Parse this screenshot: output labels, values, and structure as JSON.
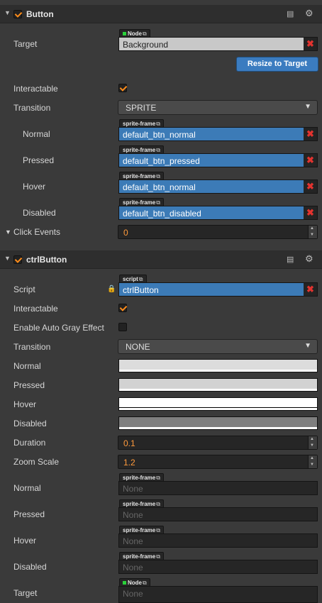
{
  "button_component": {
    "title": "Button",
    "target": {
      "label": "Target",
      "tag": "Node",
      "value": "Background"
    },
    "resize_button": "Resize to Target",
    "interactable": {
      "label": "Interactable",
      "checked": true
    },
    "transition": {
      "label": "Transition",
      "value": "SPRITE"
    },
    "sprites": [
      {
        "label": "Normal",
        "tag": "sprite-frame",
        "value": "default_btn_normal"
      },
      {
        "label": "Pressed",
        "tag": "sprite-frame",
        "value": "default_btn_pressed"
      },
      {
        "label": "Hover",
        "tag": "sprite-frame",
        "value": "default_btn_normal"
      },
      {
        "label": "Disabled",
        "tag": "sprite-frame",
        "value": "default_btn_disabled"
      }
    ],
    "click_events": {
      "label": "Click Events",
      "value": "0"
    }
  },
  "ctrl_component": {
    "title": "ctrlButton",
    "script": {
      "label": "Script",
      "tag": "script",
      "value": "ctrlButton"
    },
    "interactable": {
      "label": "Interactable",
      "checked": true
    },
    "auto_gray": {
      "label": "Enable Auto Gray Effect",
      "checked": false
    },
    "transition": {
      "label": "Transition",
      "value": "NONE"
    },
    "colors": [
      {
        "label": "Normal",
        "color": "#dcdcdc"
      },
      {
        "label": "Pressed",
        "color": "#d2d2d2"
      },
      {
        "label": "Hover",
        "color": "#ffffff"
      },
      {
        "label": "Disabled",
        "color": "#7f7f7f"
      }
    ],
    "duration": {
      "label": "Duration",
      "value": "0.1"
    },
    "zoom_scale": {
      "label": "Zoom Scale",
      "value": "1.2"
    },
    "sprites": [
      {
        "label": "Normal",
        "tag": "sprite-frame",
        "value": "None"
      },
      {
        "label": "Pressed",
        "tag": "sprite-frame",
        "value": "None"
      },
      {
        "label": "Hover",
        "tag": "sprite-frame",
        "value": "None"
      },
      {
        "label": "Disabled",
        "tag": "sprite-frame",
        "value": "None"
      }
    ],
    "target": {
      "label": "Target",
      "tag": "Node",
      "value": "None"
    }
  },
  "colors": {
    "accent_orange": "#ff8c1a",
    "asset_blue": "#3c7bb7",
    "remove_red": "#e2332f"
  }
}
